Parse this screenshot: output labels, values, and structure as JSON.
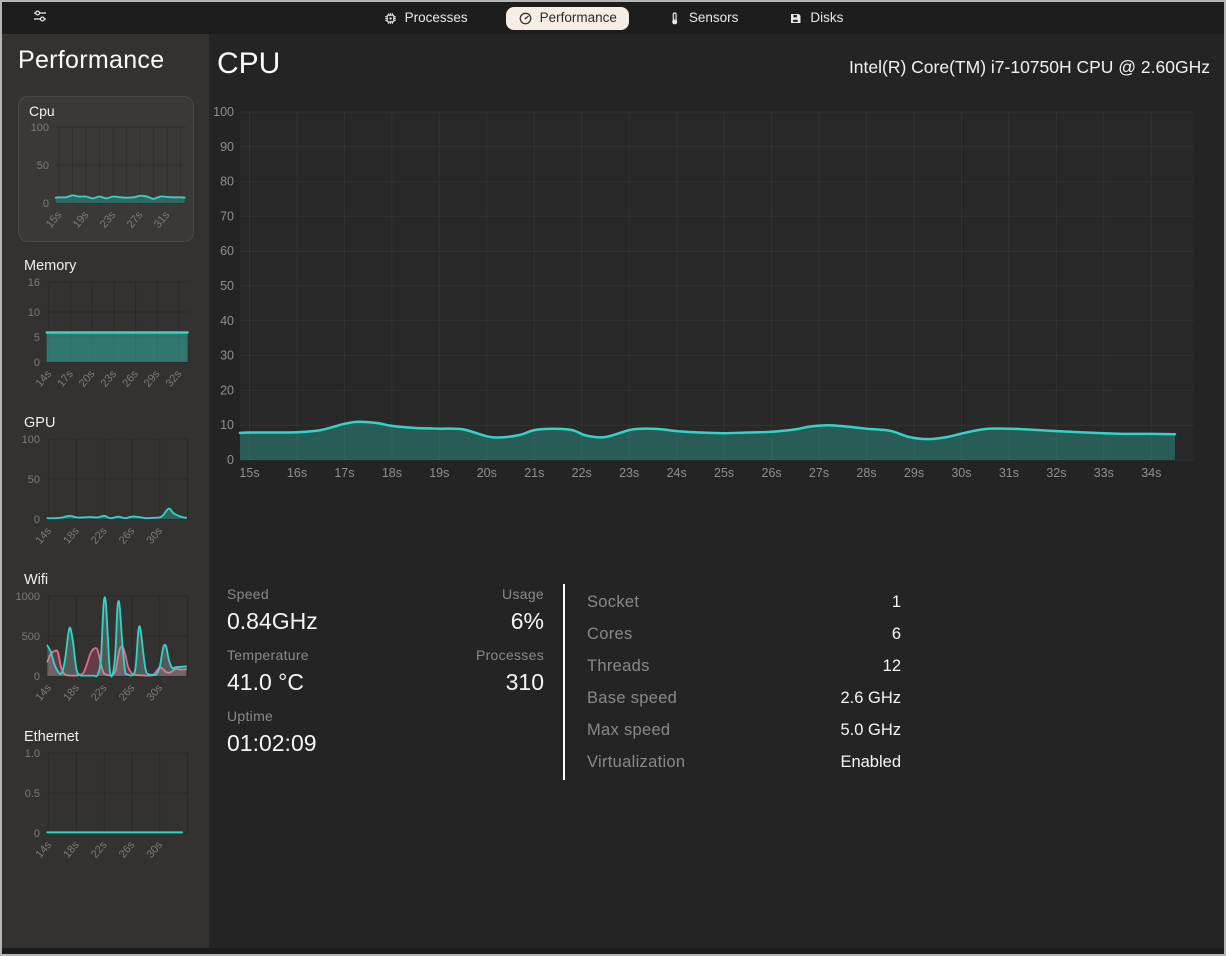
{
  "topbar": {
    "tabs": [
      {
        "label": "Processes",
        "icon": "chip-icon",
        "active": false
      },
      {
        "label": "Performance",
        "icon": "gauge-icon",
        "active": true
      },
      {
        "label": "Sensors",
        "icon": "thermometer-icon",
        "active": false
      },
      {
        "label": "Disks",
        "icon": "floppy-disk-icon",
        "active": false
      }
    ]
  },
  "sidebar": {
    "title": "Performance",
    "items": [
      {
        "label": "Cpu",
        "selected": true
      },
      {
        "label": "Memory"
      },
      {
        "label": "GPU"
      },
      {
        "label": "Wifi"
      },
      {
        "label": "Ethernet"
      }
    ]
  },
  "main": {
    "title": "CPU",
    "subtitle": "Intel(R) Core(TM) i7-10750H CPU @ 2.60GHz",
    "stats_left": [
      {
        "label": "Speed",
        "value": "0.84GHz"
      },
      {
        "label": "Temperature",
        "value": "41.0 °C"
      },
      {
        "label": "Uptime",
        "value": "01:02:09"
      }
    ],
    "stats_mid": [
      {
        "label": "Usage",
        "value": "6%"
      },
      {
        "label": "Processes",
        "value": "310"
      }
    ],
    "stats_right": [
      {
        "label": "Socket",
        "value": "1"
      },
      {
        "label": "Cores",
        "value": "6"
      },
      {
        "label": "Threads",
        "value": "12"
      },
      {
        "label": "Base speed",
        "value": "2.6 GHz"
      },
      {
        "label": "Max speed",
        "value": "5.0 GHz"
      },
      {
        "label": "Virtualization",
        "value": "Enabled"
      }
    ]
  },
  "colors": {
    "accent_line": "#30d5c8",
    "accent_fill": "rgba(48,213,200,0.30)",
    "wifi_upload_line": "#e06c8c",
    "active_tab_bg": "#f6eee4",
    "divider": "#fbfbfb"
  },
  "chart_data": {
    "main_cpu": {
      "type": "area",
      "title": "CPU utilization (%)",
      "ylim": [
        0,
        100
      ],
      "x_range": [
        14.8,
        34.9
      ],
      "margin": {
        "l": 26,
        "r": 14,
        "t": 12,
        "b": 32
      },
      "plot_bg": "#282828",
      "grid_color": "rgba(255,255,255,0.05)",
      "yticks": [
        {
          "v": 0,
          "label": "0"
        },
        {
          "v": 10,
          "label": "10"
        },
        {
          "v": 20,
          "label": "20"
        },
        {
          "v": 30,
          "label": "30"
        },
        {
          "v": 40,
          "label": "40"
        },
        {
          "v": 50,
          "label": "50"
        },
        {
          "v": 60,
          "label": "60"
        },
        {
          "v": 70,
          "label": "70"
        },
        {
          "v": 80,
          "label": "80"
        },
        {
          "v": 90,
          "label": "90"
        },
        {
          "v": 100,
          "label": "100"
        }
      ],
      "xticks": [
        {
          "v": 15,
          "label": "15s"
        },
        {
          "v": 16,
          "label": "16s"
        },
        {
          "v": 17,
          "label": "17s"
        },
        {
          "v": 18,
          "label": "18s"
        },
        {
          "v": 19,
          "label": "19s"
        },
        {
          "v": 20,
          "label": "20s"
        },
        {
          "v": 21,
          "label": "21s"
        },
        {
          "v": 22,
          "label": "22s"
        },
        {
          "v": 23,
          "label": "23s"
        },
        {
          "v": 24,
          "label": "24s"
        },
        {
          "v": 25,
          "label": "25s"
        },
        {
          "v": 26,
          "label": "26s"
        },
        {
          "v": 27,
          "label": "27s"
        },
        {
          "v": 28,
          "label": "28s"
        },
        {
          "v": 29,
          "label": "29s"
        },
        {
          "v": 30,
          "label": "30s"
        },
        {
          "v": 31,
          "label": "31s"
        },
        {
          "v": 32,
          "label": "32s"
        },
        {
          "v": 33,
          "label": "33s"
        },
        {
          "v": 34,
          "label": "34s"
        }
      ],
      "x": [
        14.8,
        15,
        15.5,
        16,
        16.5,
        17,
        17.3,
        17.7,
        18,
        18.5,
        19,
        19.5,
        20,
        20.3,
        20.7,
        21,
        21.4,
        21.8,
        22.1,
        22.5,
        23,
        23.3,
        23.7,
        24,
        24.5,
        25,
        25.5,
        26,
        26.5,
        26.8,
        27.2,
        27.6,
        28,
        28.5,
        28.9,
        29.3,
        29.7,
        30,
        30.5,
        31,
        31.5,
        32,
        32.5,
        33,
        33.5,
        34,
        34.5
      ],
      "series": [
        {
          "name": "cpu-usage",
          "stroke": "#30d5c8",
          "fill": "rgba(48,213,200,0.30)",
          "width": 2.5,
          "values": [
            7.8,
            7.9,
            7.9,
            8,
            8.6,
            10.4,
            11,
            10.6,
            9.8,
            9.2,
            9,
            8.8,
            6.8,
            6.5,
            7.2,
            8.6,
            9,
            8.6,
            7,
            6.6,
            8.6,
            9,
            8.8,
            8.3,
            7.9,
            7.7,
            7.9,
            8.1,
            8.8,
            9.6,
            10,
            9.6,
            9,
            8.4,
            6.6,
            6,
            6.6,
            7.6,
            8.9,
            9,
            8.7,
            8.3,
            8,
            7.7,
            7.5,
            7.5,
            7.4
          ]
        }
      ]
    },
    "mini_cpu": {
      "type": "area",
      "title": "Cpu",
      "ylim": [
        0,
        100
      ],
      "x_range": [
        14.4,
        33.8
      ],
      "margin": {
        "l": 34,
        "r": 5,
        "t": 6,
        "b": 32
      },
      "grid_color": "rgba(0,0,0,0.16)",
      "rotate_xticks": true,
      "yticks": [
        {
          "v": 0,
          "label": "0"
        },
        {
          "v": 50,
          "label": "50"
        },
        {
          "v": 100,
          "label": "100"
        }
      ],
      "xticks": [
        {
          "v": 15,
          "label": "15s"
        },
        {
          "v": 17,
          "label": null
        },
        {
          "v": 19,
          "label": "19s"
        },
        {
          "v": 21,
          "label": null
        },
        {
          "v": 23,
          "label": "23s"
        },
        {
          "v": 25,
          "label": null
        },
        {
          "v": 27,
          "label": "27s"
        },
        {
          "v": 29,
          "label": null
        },
        {
          "v": 31,
          "label": "31s"
        },
        {
          "v": 33,
          "label": null
        }
      ],
      "x": [
        14.5,
        15,
        16,
        17,
        18,
        19,
        20,
        21,
        22,
        23,
        24,
        25,
        26,
        27,
        28,
        29,
        30,
        31,
        32,
        33,
        33.6
      ],
      "series": [
        {
          "name": "cpu-usage",
          "stroke": "#30d5c8",
          "fill": "rgba(48,213,200,0.30)",
          "width": 1.8,
          "values": [
            7,
            7.5,
            7.5,
            10,
            8.5,
            8.5,
            6,
            8.5,
            6,
            8.5,
            7.5,
            7,
            7.5,
            9.5,
            8.5,
            5.5,
            8.5,
            8,
            7.5,
            7.5,
            7
          ]
        }
      ]
    },
    "mini_memory": {
      "type": "area",
      "title": "Memory",
      "ylim": [
        0,
        16
      ],
      "x_range": [
        13.6,
        33.4
      ],
      "margin": {
        "l": 36,
        "r": 5,
        "t": 6,
        "b": 36
      },
      "grid_color": "rgba(0,0,0,0.16)",
      "rotate_xticks": true,
      "yticks": [
        {
          "v": 0,
          "label": "0"
        },
        {
          "v": 5,
          "label": "5"
        },
        {
          "v": 10,
          "label": "10"
        },
        {
          "v": 16,
          "label": "16"
        }
      ],
      "xticks": [
        {
          "v": 14,
          "label": "14s"
        },
        {
          "v": 17,
          "label": "17s"
        },
        {
          "v": 20,
          "label": "20s"
        },
        {
          "v": 23,
          "label": "23s"
        },
        {
          "v": 26,
          "label": "26s"
        },
        {
          "v": 29,
          "label": "29s"
        },
        {
          "v": 32,
          "label": "32s"
        }
      ],
      "x": [
        13.7,
        33.2
      ],
      "series": [
        {
          "name": "memory-used-gib",
          "stroke": "#30d5c8",
          "fill": "rgba(48,213,200,0.42)",
          "width": 2.4,
          "values": [
            5.9,
            5.9
          ]
        }
      ]
    },
    "mini_gpu": {
      "type": "area",
      "title": "GPU",
      "ylim": [
        0,
        100
      ],
      "x_range": [
        13.6,
        34.2
      ],
      "margin": {
        "l": 36,
        "r": 5,
        "t": 6,
        "b": 36
      },
      "grid_color": "rgba(0,0,0,0.16)",
      "rotate_xticks": true,
      "yticks": [
        {
          "v": 0,
          "label": "0"
        },
        {
          "v": 50,
          "label": "50"
        },
        {
          "v": 100,
          "label": "100"
        }
      ],
      "xticks": [
        {
          "v": 14,
          "label": "14s"
        },
        {
          "v": 18,
          "label": "18s"
        },
        {
          "v": 22,
          "label": "22s"
        },
        {
          "v": 26,
          "label": "26s"
        },
        {
          "v": 30,
          "label": "30s"
        },
        {
          "v": 34,
          "label": null
        }
      ],
      "x": [
        13.8,
        15,
        16,
        17,
        18,
        19,
        20,
        21,
        22,
        22.5,
        23,
        24,
        24.5,
        25,
        26,
        27,
        28,
        29,
        30,
        30.5,
        31,
        31.4,
        32,
        33,
        33.8
      ],
      "series": [
        {
          "name": "gpu-usage",
          "stroke": "#30d5c8",
          "fill": "rgba(48,213,200,0.30)",
          "width": 1.8,
          "values": [
            1,
            1,
            2,
            4,
            2,
            2,
            2.5,
            2,
            4,
            2,
            1,
            3,
            2,
            1,
            3,
            2.5,
            1,
            1.5,
            2,
            5,
            11,
            13,
            7,
            3,
            1.5
          ]
        }
      ]
    },
    "mini_wifi": {
      "type": "area",
      "title": "Wifi",
      "ylim": [
        0,
        1000
      ],
      "x_range": [
        13.6,
        34.2
      ],
      "margin": {
        "l": 36,
        "r": 5,
        "t": 6,
        "b": 36
      },
      "grid_color": "rgba(0,0,0,0.16)",
      "rotate_xticks": true,
      "yticks": [
        {
          "v": 0,
          "label": "0"
        },
        {
          "v": 500,
          "label": "500"
        },
        {
          "v": 1000,
          "label": "1000"
        }
      ],
      "xticks": [
        {
          "v": 14,
          "label": "14s"
        },
        {
          "v": 18,
          "label": "18s"
        },
        {
          "v": 22,
          "label": "22s"
        },
        {
          "v": 26,
          "label": "26s"
        },
        {
          "v": 30,
          "label": "30s"
        },
        {
          "v": 34,
          "label": null
        }
      ],
      "x": [
        13.8,
        14.3,
        14.8,
        15.3,
        15.8,
        16.3,
        16.8,
        17.1,
        17.5,
        18,
        18.5,
        19,
        19.5,
        20,
        20.5,
        21,
        21.5,
        21.9,
        22.2,
        22.5,
        22.8,
        23.2,
        23.6,
        23.9,
        24.2,
        24.6,
        25,
        25.4,
        26,
        26.5,
        26.9,
        27.2,
        27.6,
        28,
        28.5,
        29,
        29.5,
        30,
        30.5,
        30.9,
        31.3,
        31.8,
        32.3,
        33,
        33.8
      ],
      "series": [
        {
          "name": "wifi-upload",
          "stroke": "#e06c8c",
          "fill": "rgba(214,86,120,0.30)",
          "width": 1.8,
          "values": [
            180,
            280,
            310,
            300,
            100,
            20,
            8,
            5,
            5,
            5,
            15,
            40,
            150,
            280,
            340,
            330,
            150,
            40,
            20,
            10,
            10,
            15,
            60,
            200,
            330,
            370,
            280,
            120,
            30,
            15,
            10,
            10,
            8,
            5,
            5,
            10,
            60,
            110,
            80,
            50,
            40,
            60,
            90,
            80,
            85
          ]
        },
        {
          "name": "wifi-download",
          "stroke": "#30d5c8",
          "fill": "rgba(150,190,190,0.30)",
          "width": 1.8,
          "values": [
            380,
            300,
            150,
            60,
            30,
            180,
            520,
            600,
            420,
            80,
            10,
            5,
            5,
            5,
            5,
            10,
            200,
            900,
            930,
            500,
            60,
            20,
            300,
            870,
            880,
            400,
            60,
            20,
            10,
            100,
            560,
            590,
            300,
            60,
            20,
            15,
            20,
            120,
            360,
            370,
            200,
            100,
            110,
            115,
            120
          ]
        }
      ]
    },
    "mini_ethernet": {
      "type": "area",
      "title": "Ethernet",
      "ylim": [
        0,
        1
      ],
      "x_range": [
        13.6,
        34.2
      ],
      "margin": {
        "l": 36,
        "r": 5,
        "t": 6,
        "b": 36
      },
      "grid_color": "rgba(0,0,0,0.16)",
      "rotate_xticks": true,
      "yticks": [
        {
          "v": 0,
          "label": "0"
        },
        {
          "v": 0.5,
          "label": "0.5"
        },
        {
          "v": 1,
          "label": "1.0"
        }
      ],
      "xticks": [
        {
          "v": 14,
          "label": "14s"
        },
        {
          "v": 18,
          "label": "18s"
        },
        {
          "v": 22,
          "label": "22s"
        },
        {
          "v": 26,
          "label": "26s"
        },
        {
          "v": 30,
          "label": "30s"
        },
        {
          "v": 34,
          "label": null
        }
      ],
      "x": [
        13.8,
        33.2
      ],
      "series": [
        {
          "name": "ethernet-traffic",
          "stroke": "#30d5c8",
          "fill": "rgba(48,213,200,0)",
          "width": 2,
          "values": [
            0.008,
            0.008
          ]
        }
      ]
    }
  }
}
